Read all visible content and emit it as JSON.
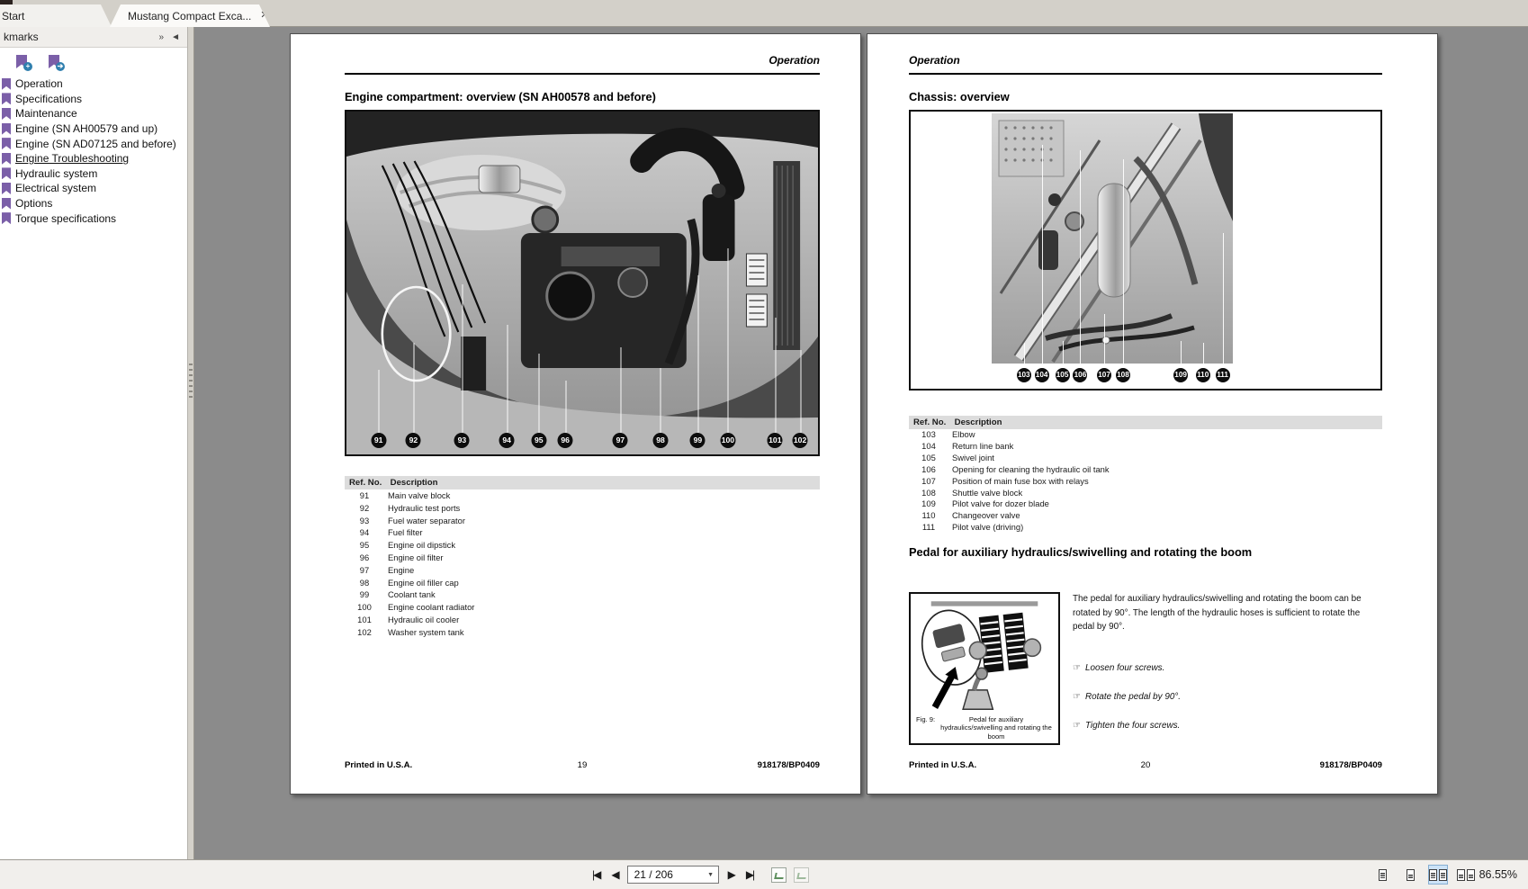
{
  "window": {
    "tabs": [
      {
        "label": "Start"
      },
      {
        "label": "Mustang Compact Exca..."
      }
    ]
  },
  "icons": {
    "close": "✕",
    "expand_bookmarks": "»",
    "collapse_panel": "◄",
    "add_badge": "+",
    "goto_badge": "➔",
    "first_page": "|◀",
    "prev_page": "◀",
    "next_page": "▶",
    "last_page": "▶|",
    "dropdown": "▼",
    "hand_bullet": "☞"
  },
  "sidebar": {
    "header": "kmarks",
    "items": [
      "Operation",
      "Specifications",
      "Maintenance",
      "Engine (SN AH00579 and up)",
      "Engine (SN AD07125 and before)",
      "Engine Troubleshooting",
      "Hydraulic system",
      "Electrical system",
      "Options",
      "Torque specifications"
    ],
    "active_item": "Engine Troubleshooting"
  },
  "pages": {
    "left": {
      "header": "Operation",
      "title": "Engine compartment: overview (SN AH00578 and before)",
      "callouts": [
        "91",
        "92",
        "93",
        "94",
        "95",
        "96",
        "97",
        "98",
        "99",
        "100",
        "101",
        "102"
      ],
      "table": {
        "col1": "Ref. No.",
        "col2": "Description",
        "rows": [
          [
            "91",
            "Main valve block"
          ],
          [
            "92",
            "Hydraulic test ports"
          ],
          [
            "93",
            "Fuel water separator"
          ],
          [
            "94",
            "Fuel filter"
          ],
          [
            "95",
            "Engine oil dipstick"
          ],
          [
            "96",
            "Engine oil filter"
          ],
          [
            "97",
            "Engine"
          ],
          [
            "98",
            "Engine oil filler cap"
          ],
          [
            "99",
            "Coolant tank"
          ],
          [
            "100",
            "Engine coolant radiator"
          ],
          [
            "101",
            "Hydraulic oil cooler"
          ],
          [
            "102",
            "Washer system tank"
          ]
        ]
      },
      "footer": {
        "left": "Printed in U.S.A.",
        "center": "19",
        "right": "918178/BP0409"
      }
    },
    "right": {
      "header": "Operation",
      "title": "Chassis: overview",
      "callouts": [
        "103",
        "104",
        "105",
        "106",
        "107",
        "108",
        "109",
        "110",
        "111"
      ],
      "table": {
        "col1": "Ref. No.",
        "col2": "Description",
        "rows": [
          [
            "103",
            "Elbow"
          ],
          [
            "104",
            "Return line bank"
          ],
          [
            "105",
            "Swivel joint"
          ],
          [
            "106",
            "Opening for cleaning the hydraulic oil tank"
          ],
          [
            "107",
            "Position of main fuse box with relays"
          ],
          [
            "108",
            "Shuttle valve block"
          ],
          [
            "109",
            "Pilot valve for dozer blade"
          ],
          [
            "110",
            "Changeover valve"
          ],
          [
            "111",
            "Pilot valve (driving)"
          ]
        ]
      },
      "section_title": "Pedal for auxiliary hydraulics/swivelling and rotating the boom",
      "figure": {
        "label": "Fig. 9:",
        "caption": "Pedal for auxiliary hydraulics/swivelling and rotating the boom"
      },
      "paragraph": "The pedal for auxiliary hydraulics/swivelling and rotating the boom can be rotated by 90°. The length of the hydraulic hoses is sufficient to rotate the pedal by 90°.",
      "steps": [
        "Loosen four screws.",
        "Rotate the pedal by 90°.",
        "Tighten the four screws."
      ],
      "footer": {
        "left": "Printed in U.S.A.",
        "center": "20",
        "right": "918178/BP0409"
      }
    }
  },
  "statusbar": {
    "page_value": "21 / 206",
    "zoom_value": "86.55%"
  },
  "colors": {
    "bookmark_purple": "#7b5fa8",
    "active_view_highlight": "#cde3f7",
    "canvas_gray": "#8b8b8b"
  }
}
